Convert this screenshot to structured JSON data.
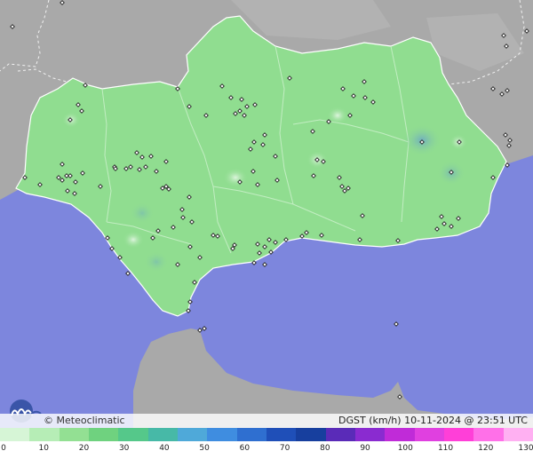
{
  "map": {
    "brand": "© Meteoclimatic",
    "caption": "DGST (km/h)   10-11-2024 @ 23:51 UTC",
    "colors": {
      "sea": "#7d86dd",
      "land_outside": "#a9a9a9",
      "region_fill": "#90dd90",
      "region_border": "#ffffff",
      "station_marker": "#222222"
    }
  },
  "legend": {
    "ticks": [
      "0",
      "10",
      "20",
      "30",
      "40",
      "50",
      "60",
      "70",
      "80",
      "90",
      "100",
      "110",
      "120",
      "130"
    ],
    "colors": [
      "#d6f5d6",
      "#b6edb6",
      "#93e093",
      "#6fd27f",
      "#55c88a",
      "#47b9a7",
      "#4fa9d9",
      "#3f8de0",
      "#2f6fd0",
      "#1f4fb8",
      "#173f9e",
      "#5a2bb8",
      "#8a2bd0",
      "#c02bd8",
      "#e040e0",
      "#ff3fd8",
      "#ff70e8",
      "#ffb0f2"
    ]
  }
}
